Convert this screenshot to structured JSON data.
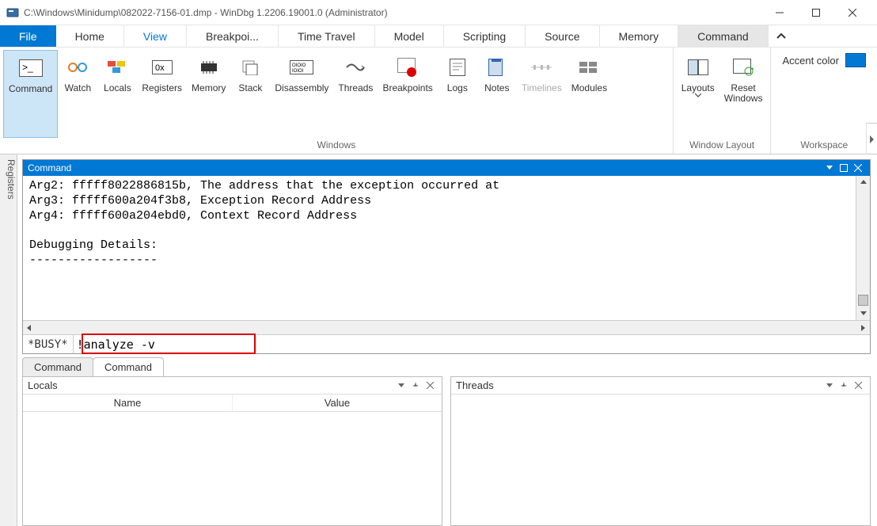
{
  "titlebar": {
    "path": "C:\\Windows\\Minidump\\082022-7156-01.dmp - WinDbg 1.2206.19001.0 (Administrator)"
  },
  "menu": {
    "file": "File",
    "home": "Home",
    "view": "View",
    "breakpoints": "Breakpoi...",
    "timetravel": "Time Travel",
    "model": "Model",
    "scripting": "Scripting",
    "source": "Source",
    "memory": "Memory",
    "command": "Command"
  },
  "ribbon": {
    "command": "Command",
    "watch": "Watch",
    "locals": "Locals",
    "registers": "Registers",
    "memory": "Memory",
    "stack": "Stack",
    "disassembly": "Disassembly",
    "threads": "Threads",
    "breakpoints": "Breakpoints",
    "logs": "Logs",
    "notes": "Notes",
    "timelines": "Timelines",
    "modules": "Modules",
    "layouts": "Layouts",
    "reset_windows": "Reset\nWindows",
    "group_windows": "Windows",
    "group_layout": "Window Layout",
    "group_workspace": "Workspace",
    "accent_label": "Accent color",
    "accent_color": "#0078d4"
  },
  "side_tab": "Registers",
  "command_window": {
    "title": "Command",
    "output": "Arg2: fffff8022886815b, The address that the exception occurred at\nArg3: fffff600a204f3b8, Exception Record Address\nArg4: fffff600a204ebd0, Context Record Address\n\nDebugging Details:\n------------------",
    "status": "*BUSY*",
    "input_value": "!analyze -v"
  },
  "bottom_tabs": {
    "t1": "Command",
    "t2": "Command"
  },
  "panels": {
    "locals_title": "Locals",
    "locals_col_name": "Name",
    "locals_col_value": "Value",
    "threads_title": "Threads"
  }
}
